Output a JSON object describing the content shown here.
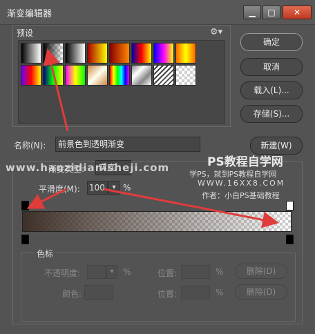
{
  "window": {
    "title": "渐变编辑器",
    "minimize": "▁",
    "maximize": "□",
    "close": "✕"
  },
  "presets": {
    "label": "预设",
    "menu_icon": "⚙▾",
    "swatches": [
      [
        "linear-gradient(90deg,#000,#fff)",
        "checker-black",
        "linear-gradient(90deg,#000,#fff)",
        "linear-gradient(90deg,#a00,#ff0)",
        "linear-gradient(90deg,#800,#f80)",
        "linear-gradient(90deg,#00a,#f00,#ff0)",
        "linear-gradient(90deg,#00f,#f0f,#ff0)",
        "linear-gradient(90deg,#f60,#ff0,#f60)"
      ],
      [
        "linear-gradient(90deg,#60f,#f00,#ff0)",
        "linear-gradient(90deg,#008,#0f0,#ff0)",
        "linear-gradient(90deg,#f0f,#ff0,#0f0)",
        "linear-gradient(135deg,#c84,#ffe,#c84)",
        "linear-gradient(90deg,#f00,#ff0,#0f0,#0ff,#00f,#f0f)",
        "linear-gradient(135deg,#888,#fff,#888,#fff)",
        "stripes",
        "checker-plain"
      ]
    ]
  },
  "buttons": {
    "ok": "确定",
    "cancel": "取消",
    "load": "载入(L)...",
    "save": "存储(S)...",
    "new": "新建(W)"
  },
  "name": {
    "label": "名称(N):",
    "value": "前景色到透明渐变"
  },
  "gradient_type": {
    "label": "渐变类型:",
    "value": "实底"
  },
  "smoothness": {
    "label": "平滑度(M):",
    "value": "100",
    "unit": "%"
  },
  "color_stops": {
    "label": "色标",
    "opacity_label": "不透明度:",
    "opacity_unit": "%",
    "position_label": "位置:",
    "position_unit": "%",
    "delete_label": "删除(D)",
    "color_label": "颜色:",
    "position2_label": "位置:",
    "position2_unit": "%",
    "delete2_label": "删除(D)"
  },
  "gradient": {
    "start_color": "#3e3028",
    "end_color": "transparent"
  },
  "watermarks": {
    "site": "www.hanzidianisheji.com",
    "ps_title": "PS教程自学网",
    "ps_sub": "学PS，就到PS教程自学网",
    "ps_url": "WWW.16XX8.COM",
    "ps_author": "作者：小白PS基础教程"
  },
  "colors": {
    "panel": "#535353",
    "arrow": "#e03c3c",
    "close": "#c8442c"
  }
}
